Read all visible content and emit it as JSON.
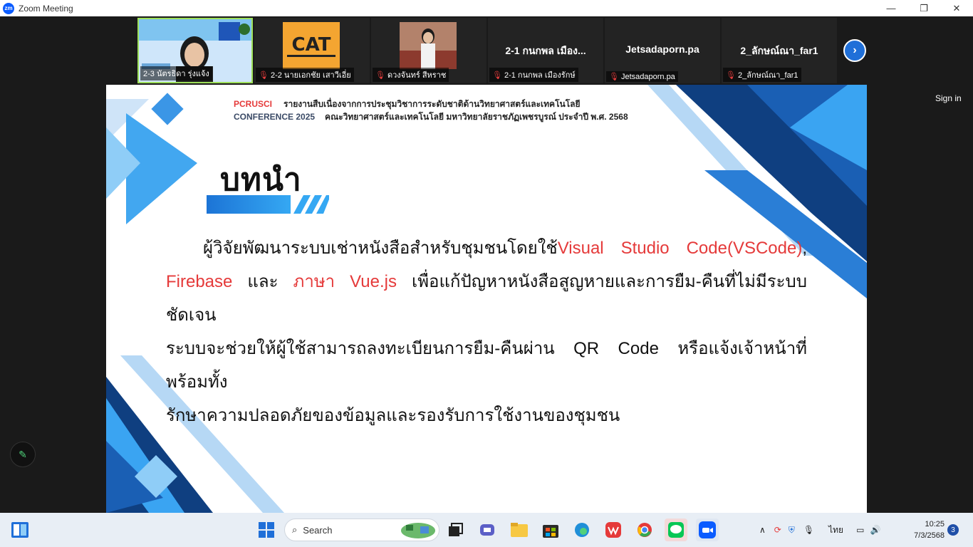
{
  "window": {
    "app_logo": "zm",
    "title": "Zoom Meeting",
    "controls": [
      "—",
      "❐",
      "✕"
    ]
  },
  "participants": [
    {
      "label": "2-3 นัตรธิดา รุ่งแจ้ง",
      "muted": false,
      "display": "video"
    },
    {
      "label": "2-2 นายเอกชัย เสาวีเอี่ย",
      "muted": true,
      "display": "video"
    },
    {
      "label": "ดวงจันทร์ สีหราช",
      "muted": true,
      "display": "video"
    },
    {
      "label": "2-1 กนกพล เมืองรักษ์",
      "muted": true,
      "display": "name",
      "center_name": "2-1 กนกพล เมือง..."
    },
    {
      "label": "Jetsadaporn.pa",
      "muted": true,
      "display": "name",
      "center_name": "Jetsadaporn.pa"
    },
    {
      "label": "2_ลักษณ์ณา_far1",
      "muted": true,
      "display": "name",
      "center_name": "2_ลักษณ์ณา_far1"
    }
  ],
  "next_arrow": "›",
  "sign_in": "Sign in",
  "thumb_text": {
    "cat": "CAT"
  },
  "slide": {
    "header_tag1": "PCRUSCI",
    "header_text1": "รายงานสืบเนื่องจากการประชุมวิชาการระดับชาติด้านวิทยาศาสตร์และเทคโนโลยี",
    "header_tag2": "CONFERENCE 2025",
    "header_text2": "คณะวิทยาศาสตร์และเทคโนโลยี มหาวิทยาลัยราชภัฏเพชรบูรณ์ ประจำปี พ.ศ. 2568",
    "heading": "บทนำ",
    "line1_a": "ผู้วิจัยพัฒนาระบบเช่าหนังสือสำหรับชุมชนโดยใช้",
    "line1_red": "Visual Studio Code(VSCode)",
    "line1_b": ",",
    "line2_red1": "Firebase",
    "line2_and": " และ ",
    "line2_red2": "ภาษา Vue.js",
    "line2_b": " เพื่อแก้ปัญหาหนังสือสูญหายและการยืม-คืนที่ไม่มีระบบชัดเจน",
    "line3": "ระบบจะช่วยให้ผู้ใช้สามารถลงทะเบียนการยืม-คืนผ่าน QR Code หรือแจ้งเจ้าหน้าที่ พร้อมทั้ง",
    "line4": "รักษาความปลอดภัยของข้อมูลและรองรับการใช้งานของชุมชน",
    "accent_red": "#e53a3a",
    "accent_blue": "#1c74d6"
  },
  "taskbar": {
    "search_placeholder": "Search",
    "language": "ไทย",
    "time": "10:25",
    "date": "7/3/2568",
    "notification_count": "3"
  }
}
